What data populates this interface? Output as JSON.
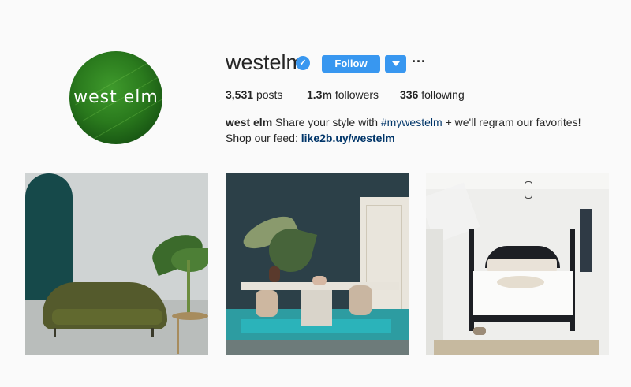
{
  "profile": {
    "avatar_text": "west elm",
    "username": "westelm",
    "verified_icon": "verified-badge-icon",
    "follow_label": "Follow",
    "more_label": "···"
  },
  "stats": {
    "posts_count": "3,531",
    "posts_label": "posts",
    "followers_count": "1.3m",
    "followers_label": "followers",
    "following_count": "336",
    "following_label": "following"
  },
  "bio": {
    "name": "west elm",
    "text_before": "Share your style with",
    "hashtag": "#mywestelm",
    "text_after": "+ we'll regram our favorites! Shop our feed:",
    "link": "like2b.uy/westelm"
  },
  "posts": [
    {
      "name": "post-sofa"
    },
    {
      "name": "post-dining"
    },
    {
      "name": "post-bedroom"
    }
  ],
  "colors": {
    "accent": "#3897f0",
    "text": "#262626",
    "link": "#003569",
    "background": "#fafafa"
  }
}
